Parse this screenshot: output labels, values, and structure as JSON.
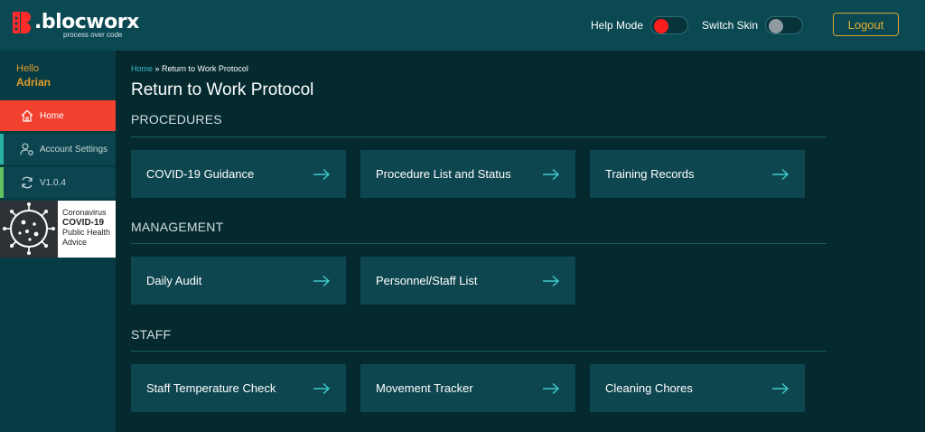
{
  "header": {
    "logo_text": ".blocworx",
    "logo_tagline": "process over code",
    "help_mode_label": "Help Mode",
    "switch_skin_label": "Switch Skin",
    "logout_label": "Logout",
    "colors": {
      "bar": "#0a4852",
      "help_on": "#ff1e1e",
      "logout": "#e0ad33"
    }
  },
  "sidebar": {
    "greeting": "Hello",
    "username": "Adrian",
    "items": [
      {
        "label": "Home",
        "icon": "home-icon",
        "active": true
      },
      {
        "label": "Account Settings",
        "icon": "user-gear-icon",
        "active": false
      },
      {
        "label": "V1.0.4",
        "icon": "refresh-icon",
        "active": false
      }
    ],
    "covid": {
      "line1": "Coronavirus",
      "line2": "COVID-19",
      "line3": "Public Health",
      "line4": "Advice"
    }
  },
  "main": {
    "breadcrumb": {
      "home": "Home",
      "separator": " » ",
      "current": "Return to Work Protocol"
    },
    "title": "Return to Work Protocol",
    "sections": [
      {
        "title": "PROCEDURES",
        "cards": [
          "COVID-19 Guidance",
          "Procedure List and Status",
          "Training Records"
        ]
      },
      {
        "title": "MANAGEMENT",
        "cards": [
          "Daily Audit",
          "Personnel/Staff List"
        ]
      },
      {
        "title": "STAFF",
        "cards": [
          "Staff Temperature Check",
          "Movement Tracker",
          "Cleaning Chores"
        ]
      }
    ],
    "accent_arrow": "#3fc9c9"
  }
}
